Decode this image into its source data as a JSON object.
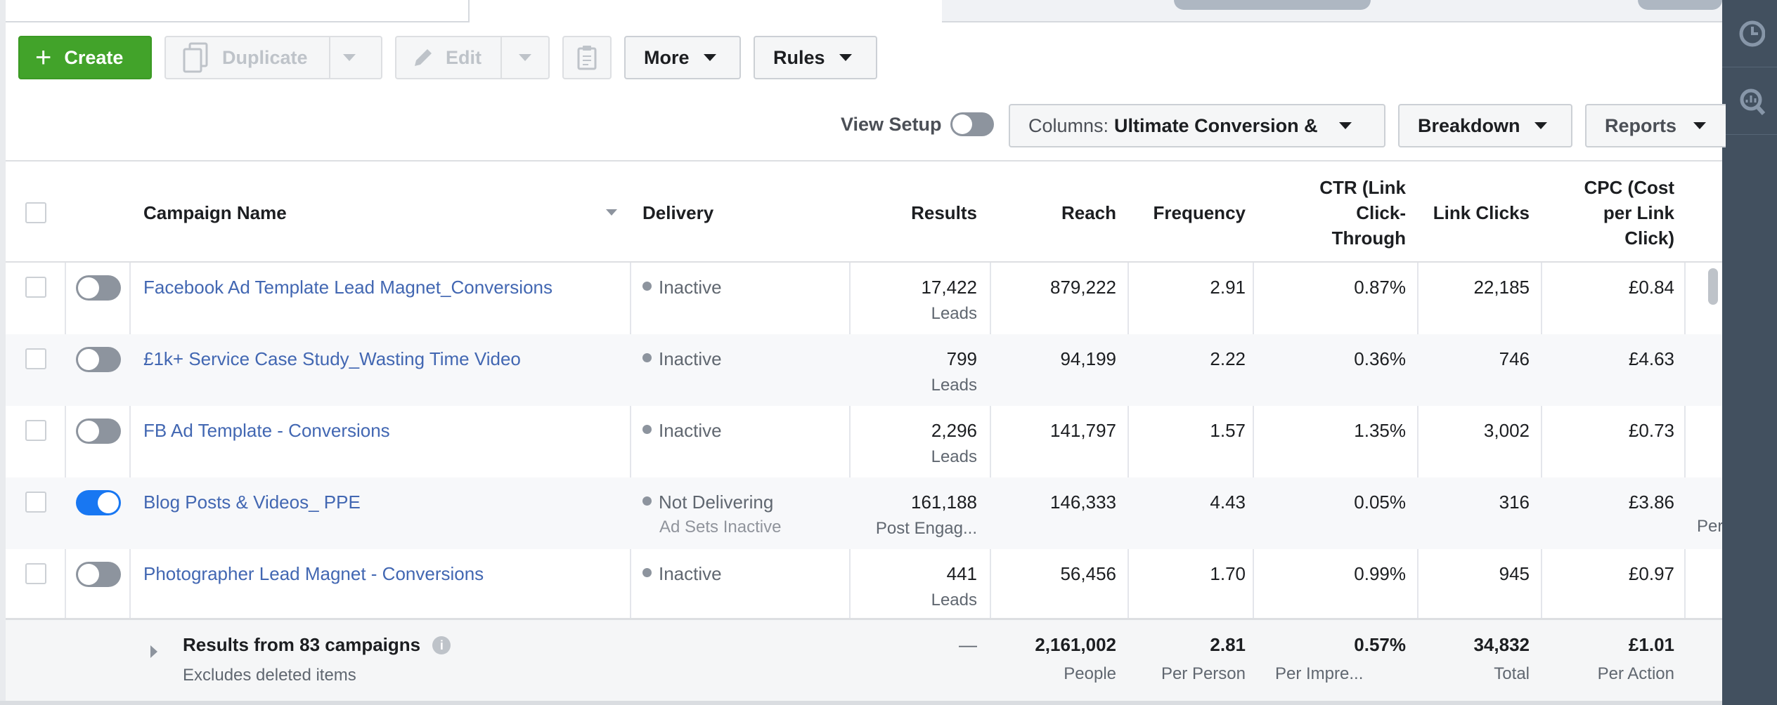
{
  "toolbar": {
    "create_label": "Create",
    "duplicate_label": "Duplicate",
    "edit_label": "Edit",
    "more_label": "More",
    "rules_label": "Rules"
  },
  "view_controls": {
    "view_setup_label": "View Setup",
    "columns_prefix": "Columns:",
    "columns_value": "Ultimate Conversion &",
    "breakdown_label": "Breakdown",
    "reports_label": "Reports"
  },
  "table": {
    "headers": {
      "campaign_name": "Campaign Name",
      "delivery": "Delivery",
      "results": "Results",
      "reach": "Reach",
      "frequency": "Frequency",
      "ctr_line1": "CTR (Link",
      "ctr_line2": "Click-",
      "ctr_line3": "Through",
      "link_clicks": "Link Clicks",
      "cpc_line1": "CPC (Cost",
      "cpc_line2": "per Link",
      "cpc_line3": "Click)"
    },
    "rows": [
      {
        "on": false,
        "name": "Facebook Ad Template Lead Magnet_Conversions",
        "delivery": "Inactive",
        "delivery_sub": "",
        "results": "17,422",
        "results_sub": "Leads",
        "reach": "879,222",
        "frequency": "2.91",
        "ctr": "0.87%",
        "link_clicks": "22,185",
        "cpc": "£0.84",
        "extra": ""
      },
      {
        "on": false,
        "name": "£1k+ Service Case Study_Wasting Time Video",
        "delivery": "Inactive",
        "delivery_sub": "",
        "results": "799",
        "results_sub": "Leads",
        "reach": "94,199",
        "frequency": "2.22",
        "ctr": "0.36%",
        "link_clicks": "746",
        "cpc": "£4.63",
        "extra": ""
      },
      {
        "on": false,
        "name": "FB Ad Template - Conversions",
        "delivery": "Inactive",
        "delivery_sub": "",
        "results": "2,296",
        "results_sub": "Leads",
        "reach": "141,797",
        "frequency": "1.57",
        "ctr": "1.35%",
        "link_clicks": "3,002",
        "cpc": "£0.73",
        "extra": ""
      },
      {
        "on": true,
        "name": "Blog Posts & Videos_ PPE",
        "delivery": "Not Delivering",
        "delivery_sub": "Ad Sets Inactive",
        "results": "161,188",
        "results_sub": "Post Engag...",
        "reach": "146,333",
        "frequency": "4.43",
        "ctr": "0.05%",
        "link_clicks": "316",
        "cpc": "£3.86",
        "extra": "Per"
      },
      {
        "on": false,
        "name": "Photographer Lead Magnet - Conversions",
        "delivery": "Inactive",
        "delivery_sub": "",
        "results": "441",
        "results_sub": "Leads",
        "reach": "56,456",
        "frequency": "1.70",
        "ctr": "0.99%",
        "link_clicks": "945",
        "cpc": "£0.97",
        "extra": ""
      }
    ],
    "footer": {
      "title": "Results from 83 campaigns",
      "subtitle": "Excludes deleted items",
      "results": "—",
      "reach": "2,161,002",
      "reach_sub": "People",
      "frequency": "2.81",
      "frequency_sub": "Per Person",
      "ctr": "0.57%",
      "ctr_sub": "Per Impre...",
      "link_clicks": "34,832",
      "link_clicks_sub": "Total",
      "cpc": "£1.01",
      "cpc_sub": "Per Action"
    }
  },
  "colors": {
    "create_green": "#42a32a",
    "link_blue": "#4267b2",
    "toggle_on": "#1877f2",
    "sidebar_dark": "#42505f"
  }
}
